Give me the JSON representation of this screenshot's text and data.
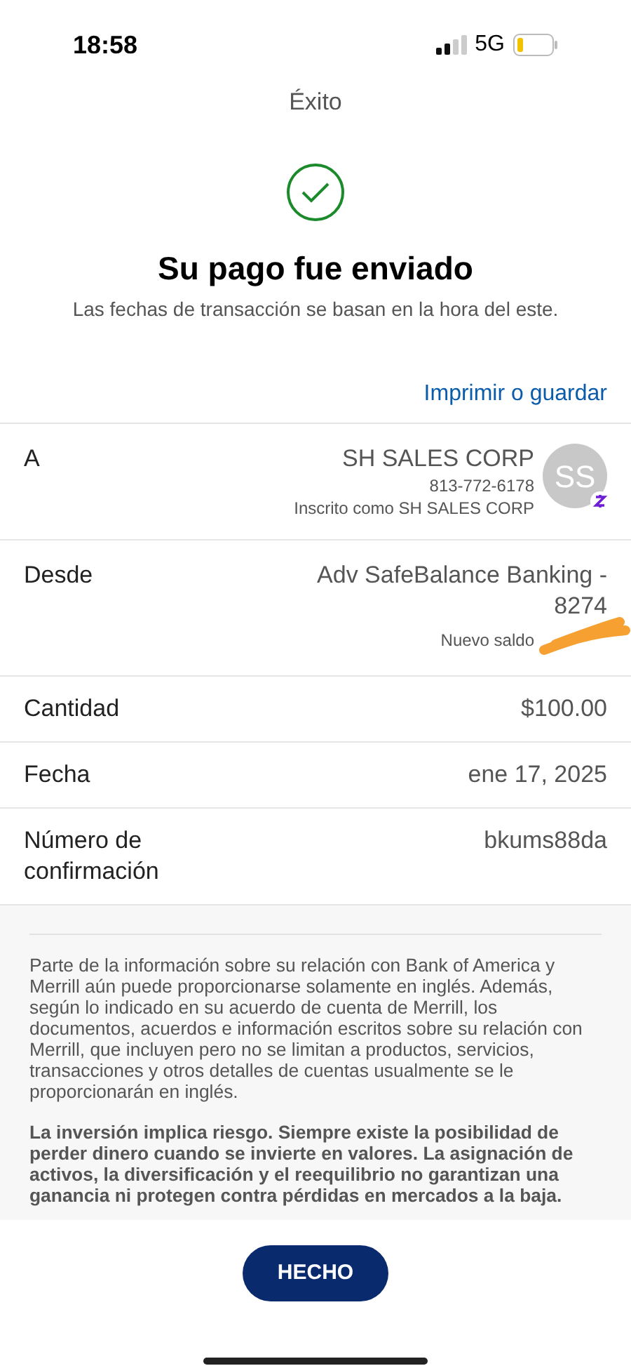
{
  "status_bar": {
    "time": "18:58",
    "network": "5G"
  },
  "header": {
    "title": "Éxito"
  },
  "success": {
    "title": "Su pago fue enviado",
    "subtitle": "Las fechas de transacción se basan en la hora del este."
  },
  "print_link": "Imprimir o guardar",
  "details": [
    {
      "kind": "recipient",
      "label": "A",
      "value": "SH SALES CORP",
      "phone": "813-772-6178",
      "enrolled": "Inscrito como SH SALES CORP",
      "avatar": "SS"
    },
    {
      "kind": "account",
      "label": "Desde",
      "value": "Adv SafeBalance Banking - 8274",
      "balance_label": "Nuevo saldo"
    },
    {
      "kind": "plain",
      "label": "Cantidad",
      "value": "$100.00"
    },
    {
      "kind": "plain",
      "label": "Fecha",
      "value": "ene 17, 2025"
    },
    {
      "kind": "plain",
      "label": "Número de confirmación",
      "value": "bkums88da"
    }
  ],
  "disclosures": [
    {
      "kind": "normal",
      "text": "Parte de la información sobre su relación con Bank of America y Merrill aún puede proporcionarse solamente en inglés. Además, según lo indicado en su acuerdo de cuenta de Merrill, los documentos, acuerdos e información escritos sobre su relación con Merrill, que incluyen pero no se limitan a productos, servicios, transacciones y otros detalles de cuentas usualmente se le proporcionarán en inglés."
    },
    {
      "kind": "bold",
      "text": "La inversión implica riesgo. Siempre existe la posibilidad de perder dinero cuando se invierte en valores. La asignación de activos, la diversificación y el reequilibrio no garantizan una ganancia ni protegen contra pérdidas en mercados a la baja."
    }
  ],
  "done_button": "HECHO"
}
